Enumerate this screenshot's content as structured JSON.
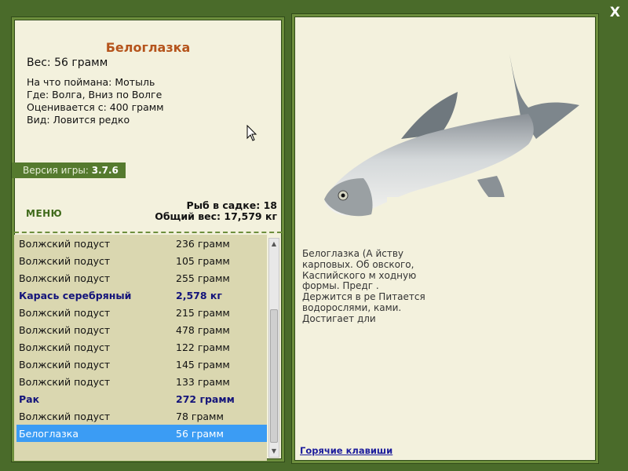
{
  "close_label": "X",
  "fish": {
    "title": "Белоглазка",
    "weight": "Вес: 56 грамм",
    "bait": "На что поймана: Мотыль",
    "where": "Где: Волга, Вниз по Волге",
    "value": "Оценивается с: 400 грамм",
    "kind": "Вид: Ловится редко"
  },
  "version": {
    "label": "Версия игры:",
    "number": "3.7.6"
  },
  "menu_label": "МЕНЮ",
  "cage": {
    "count": "Рыб в садке: 18",
    "total": "Общий вес: 17,579 кг"
  },
  "catch_list": [
    {
      "name": "Волжский подуст",
      "weight": "236 грамм"
    },
    {
      "name": "Волжский подуст",
      "weight": "105 грамм"
    },
    {
      "name": "Волжский подуст",
      "weight": "255 грамм"
    },
    {
      "name": "Карась серебряный",
      "weight": "2,578 кг"
    },
    {
      "name": "Волжский подуст",
      "weight": "215 грамм"
    },
    {
      "name": "Волжский подуст",
      "weight": "478 грамм"
    },
    {
      "name": "Волжский подуст",
      "weight": "122 грамм"
    },
    {
      "name": "Волжский подуст",
      "weight": "145 грамм"
    },
    {
      "name": "Волжский подуст",
      "weight": "133 грамм"
    },
    {
      "name": "Рак",
      "weight": "272 грамм"
    },
    {
      "name": "Волжский подуст",
      "weight": "78 грамм"
    },
    {
      "name": "Белоглазка",
      "weight": "56 грамм"
    }
  ],
  "description": [
    "Белоглазка (А                                          йству",
    "карповых. Об                                           овского,",
    "Каспийского м                                          ходную",
    "формы. Предг                                          .",
    "Держится в ре                                         Питается",
    "водорослями,                                          ками.",
    "Достигает дли"
  ],
  "hotkeys_label": "Горячие клавиши",
  "colors": {
    "bg": "#4a6b2a",
    "panel": "#f3f1dd",
    "accent": "#557a2e",
    "selected": "#3b9cf4",
    "title": "#b5541c"
  }
}
